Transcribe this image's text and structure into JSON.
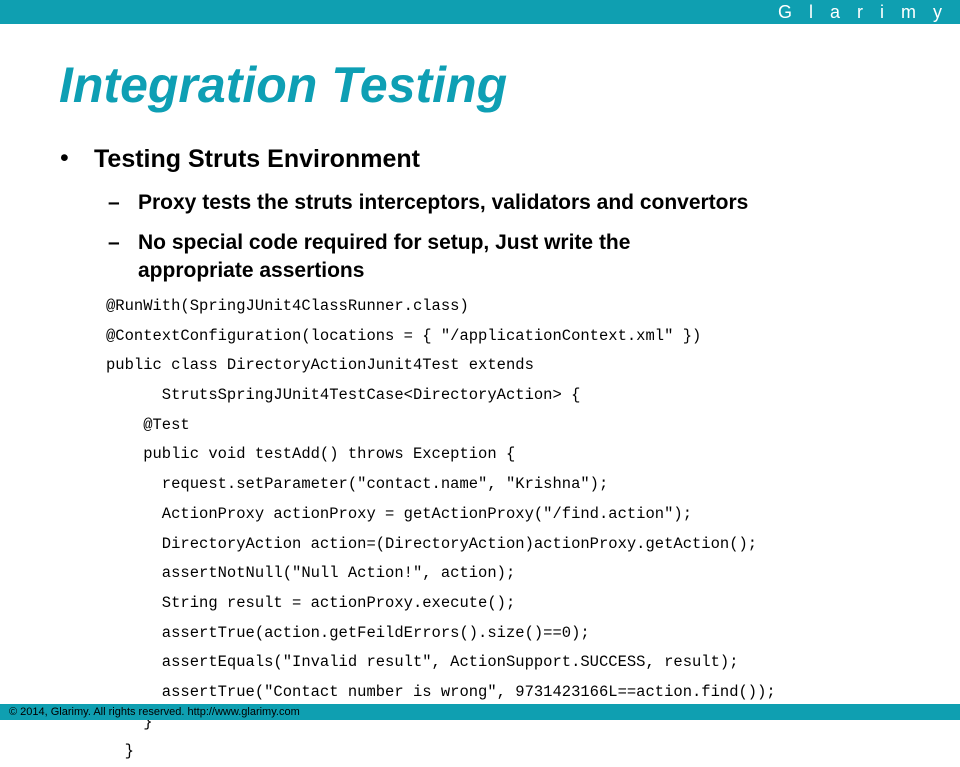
{
  "brand": "G l a r i m y",
  "title": "Integration Testing",
  "bullet": {
    "marker": "•",
    "text": "Testing Struts Environment"
  },
  "sub_items": [
    {
      "marker": "–",
      "lines": [
        "Proxy tests the struts interceptors, validators and convertors"
      ]
    },
    {
      "marker": "–",
      "lines": [
        "No special code required for setup, Just write the",
        "appropriate assertions"
      ]
    }
  ],
  "code_lines": [
    "@RunWith(SpringJUnit4ClassRunner.class)",
    "@ContextConfiguration(locations = { \"/applicationContext.xml\" })",
    "public class DirectoryActionJunit4Test extends",
    "      StrutsSpringJUnit4TestCase<DirectoryAction> {",
    "    @Test",
    "    public void testAdd() throws Exception {",
    "      request.setParameter(\"contact.name\", \"Krishna\");",
    "      ActionProxy actionProxy = getActionProxy(\"/find.action\");",
    "      DirectoryAction action=(DirectoryAction)actionProxy.getAction();",
    "      assertNotNull(\"Null Action!\", action);",
    "      String result = actionProxy.execute();",
    "      assertTrue(action.getFeildErrors().size()==0);",
    "      assertEquals(\"Invalid result\", ActionSupport.SUCCESS, result);",
    "      assertTrue(\"Contact number is wrong\", 9731423166L==action.find());",
    "    }",
    "  }"
  ],
  "footer": "© 2014, Glarimy. All rights reserved. http://www.glarimy.com"
}
